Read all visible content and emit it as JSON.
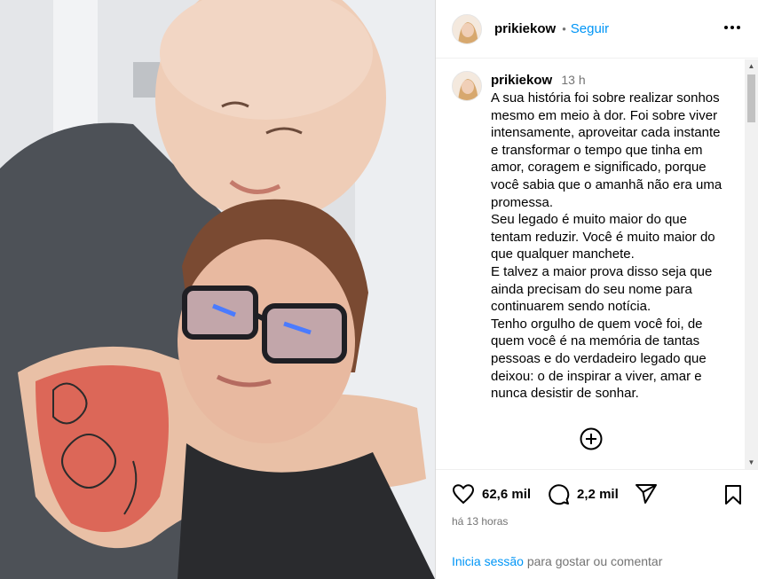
{
  "post": {
    "username": "prikiekow",
    "follow_label": "Seguir",
    "separator": "•",
    "more_icon": "more-horizontal-icon"
  },
  "caption": {
    "username": "prikiekow",
    "time": "13 h",
    "paragraphs": [
      "A sua história foi sobre realizar sonhos mesmo em meio à dor. Foi sobre viver intensamente, aproveitar cada instante e transformar o tempo que tinha em amor, coragem e significado, porque você sabia que o amanhã não era uma promessa.",
      "Seu legado é muito maior do que tentam reduzir. Você é muito maior do que qualquer manchete.",
      "E talvez a maior prova disso seja que ainda precisam do seu nome para continuarem sendo notícia.",
      "Tenho orgulho de quem você foi, de quem você é na memória de tantas pessoas e do verdadeiro legado que deixou: o de inspirar a viver, amar e nunca desistir de sonhar."
    ]
  },
  "actions": {
    "likes": "62,6 mil",
    "comments": "2,2 mil",
    "icons": [
      "heart-icon",
      "comment-icon",
      "share-icon",
      "bookmark-icon"
    ]
  },
  "time_ago": "há 13 horas",
  "login": {
    "link": "Inicia sessão",
    "rest": " para gostar ou comentar"
  },
  "colors": {
    "link_blue": "#0095f6",
    "muted": "#737373"
  }
}
